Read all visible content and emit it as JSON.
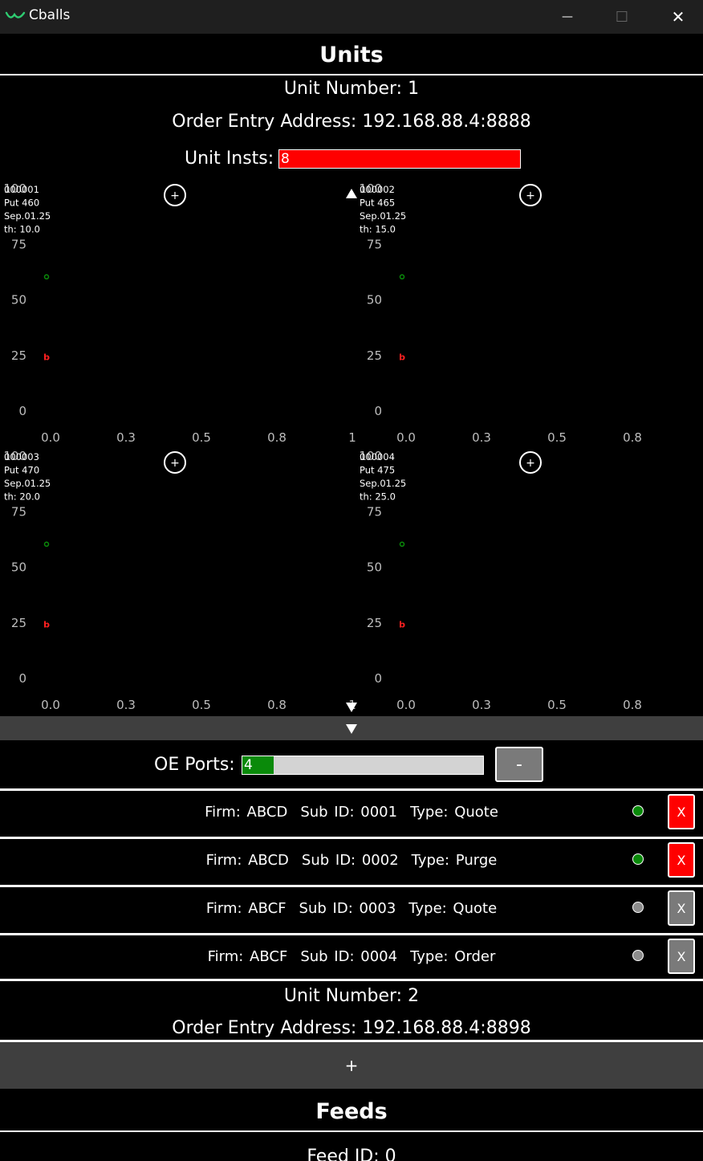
{
  "window": {
    "title": "Cballs",
    "minimize": "—",
    "maximize": "☐",
    "close": "✕"
  },
  "units_header": "Units",
  "unit1": {
    "number_text": "Unit Number: 1",
    "address_text": "Order Entry Address: 192.168.88.4:8888",
    "insts_label": "Unit Insts:",
    "insts_value": "8",
    "charts": [
      {
        "id": "000001",
        "inst": "Put 460",
        "date": "Sep.01.25",
        "th": "th: 10.0",
        "add": "+"
      },
      {
        "id": "000002",
        "inst": "Put 465",
        "date": "Sep.01.25",
        "th": "th: 15.0",
        "add": "+"
      },
      {
        "id": "000003",
        "inst": "Put 470",
        "date": "Sep.01.25",
        "th": "th: 20.0",
        "add": "+"
      },
      {
        "id": "000004",
        "inst": "Put 475",
        "date": "Sep.01.25",
        "th": "th: 25.0",
        "add": "+"
      }
    ],
    "oe_label": "OE Ports:",
    "oe_value": "4",
    "oe_fraction": 0.13,
    "minus": "-",
    "ports": [
      {
        "firm": "Firm: ABCD",
        "sub": "Sub ID: 0001",
        "type": "Type: Quote",
        "status": "#0a8a0a",
        "btn": "#ff0000",
        "x": "X"
      },
      {
        "firm": "Firm: ABCD",
        "sub": "Sub ID: 0002",
        "type": "Type: Purge",
        "status": "#0a8a0a",
        "btn": "#ff0000",
        "x": "X"
      },
      {
        "firm": "Firm: ABCF",
        "sub": "Sub ID: 0003",
        "type": "Type: Quote",
        "status": "#8c8c8c",
        "btn": "#7a7a7a",
        "x": "X"
      },
      {
        "firm": "Firm: ABCF",
        "sub": "Sub ID: 0004",
        "type": "Type: Order",
        "status": "#8c8c8c",
        "btn": "#7a7a7a",
        "x": "X"
      }
    ]
  },
  "unit2": {
    "number_text": "Unit Number: 2",
    "address_text": "Order Entry Address: 192.168.88.4:8898"
  },
  "add_unit": "+",
  "feeds_header": "Feeds",
  "feed_text": "Feed ID: 0",
  "chart_data": {
    "type": "scatter",
    "y_ticks": [
      "100",
      "75",
      "50",
      "25",
      "0"
    ],
    "x_ticks": [
      "0.0",
      "0.3",
      "0.5",
      "0.8",
      "1"
    ],
    "ylim": [
      0,
      100
    ],
    "xlim": [
      0,
      1
    ],
    "series": [
      {
        "marker": "o",
        "x": 0.0,
        "y": 60,
        "color": "#0a8a0a"
      },
      {
        "marker": "b",
        "x": 0.0,
        "y": 24,
        "color": "#ff2020"
      }
    ]
  }
}
